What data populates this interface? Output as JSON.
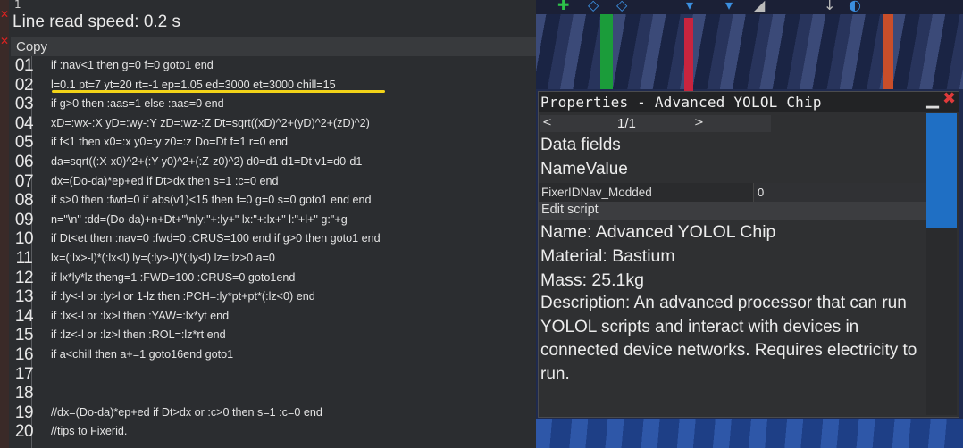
{
  "editor": {
    "top_digit": "1",
    "line_read_speed": "Line read speed: 0.2 s",
    "copy_label": "Copy",
    "lines": [
      {
        "num": "01",
        "code": "if :nav<1 then g=0 f=0 goto1 end"
      },
      {
        "num": "02",
        "code": "l=0.1 pt=7 yt=20 rt=-1 ep=1.05 ed=3000 et=3000 chill=15"
      },
      {
        "num": "03",
        "code": "if g>0 then :aas=1 else :aas=0 end"
      },
      {
        "num": "04",
        "code": "xD=:wx-:X yD=:wy-:Y zD=:wz-:Z Dt=sqrt((xD)^2+(yD)^2+(zD)^2)"
      },
      {
        "num": "05",
        "code": "if f<1 then x0=:x y0=:y z0=:z Do=Dt f=1 r=0 end"
      },
      {
        "num": "06",
        "code": "da=sqrt((:X-x0)^2+(:Y-y0)^2+(:Z-z0)^2) d0=d1 d1=Dt v1=d0-d1"
      },
      {
        "num": "07",
        "code": "dx=(Do-da)*ep+ed if Dt>dx then s=1 :c=0 end"
      },
      {
        "num": "08",
        "code": "if s>0 then :fwd=0 if abs(v1)<15 then f=0 g=0 s=0 goto1 end end"
      },
      {
        "num": "09",
        "code": "n=\"\\n\" :dd=(Do-da)+n+Dt+\"\\nly:\"+:ly+\" lx:\"+:lx+\" l:\"+l+\" g:\"+g"
      },
      {
        "num": "10",
        "code": "if Dt<et then :nav=0 :fwd=0 :CRUS=100 end if g>0 then goto1 end"
      },
      {
        "num": "11",
        "code": "lx=(:lx>-l)*(:lx<l) ly=(:ly>-l)*(:ly<l) lz=:lz>0 a=0"
      },
      {
        "num": "12",
        "code": "if lx*ly*lz theng=1 :FWD=100 :CRUS=0 goto1end"
      },
      {
        "num": "13",
        "code": "if :ly<-l or :ly>l or 1-lz then :PCH=:ly*pt+pt*(:lz<0) end"
      },
      {
        "num": "14",
        "code": "if :lx<-l or :lx>l then :YAW=:lx*yt end"
      },
      {
        "num": "15",
        "code": "if :lz<-l or :lz>l then :ROL=:lz*rt end"
      },
      {
        "num": "16",
        "code": "if a<chill then a+=1 goto16end goto1"
      },
      {
        "num": "17",
        "code": ""
      },
      {
        "num": "18",
        "code": ""
      },
      {
        "num": "19",
        "code": "//dx=(Do-da)*ep+ed if Dt>dx or :c>0 then s=1 :c=0 end"
      },
      {
        "num": "20",
        "code": "//tips to Fixerid."
      }
    ]
  },
  "properties": {
    "title": "Properties - Advanced YOLOL Chip",
    "pager_prev": "<",
    "pager_count": "1/1",
    "pager_next": ">",
    "data_fields": "Data fields",
    "name_value_header": "NameValue",
    "field_name": "FixerIDNav_Modded",
    "field_value": "0",
    "edit_script": "Edit script",
    "name": "Name: Advanced YOLOL Chip",
    "material": "Material: Bastium",
    "mass": "Mass: 25.1kg",
    "description": "Description: An advanced processor that can run YOLOL scripts and interact with devices in connected device networks. Requires electricity to run."
  },
  "colors": {
    "highlight": "#f2d318",
    "scroll_thumb": "#1f6fc4",
    "close": "#e03a3a"
  }
}
